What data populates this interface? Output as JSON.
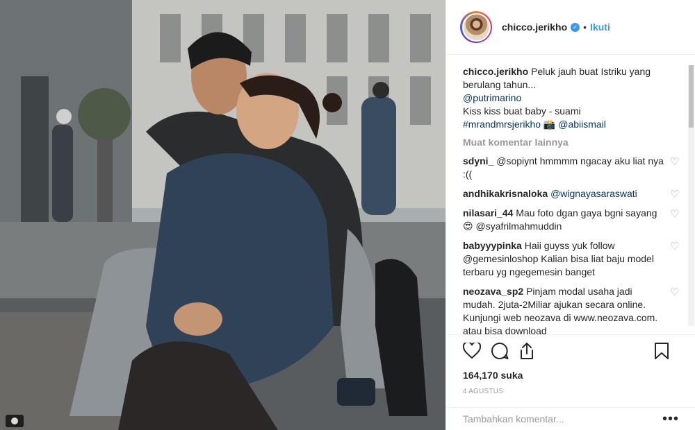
{
  "post": {
    "username": "chicco.jerikho",
    "follow_label": "Ikuti",
    "separator": "•",
    "caption_lines": [
      "Peluk jauh buat Istriku yang berulang tahun...",
      "@putrimarino",
      "Kiss kiss buat baby - suami",
      "#mrandmrsjerikho 📸 @abiismail"
    ],
    "load_more_label": "Muat komentar lainnya",
    "likes": "164,170 suka",
    "date": "4 AGUSTUS",
    "add_comment_placeholder": "Tambahkan komentar...",
    "more_options": "•••"
  },
  "comments": [
    {
      "user": "sdyni_",
      "text": "@sopiynt hmmmm ngacay aku liat nya :(("
    },
    {
      "user": "andhikakrisnaloka",
      "text": "@wignayasaraswati"
    },
    {
      "user": "nilasari_44",
      "text": "Mau foto dgan gaya bgni sayang 😍 @syafrilmahmuddin"
    },
    {
      "user": "babyyypinka",
      "text": "Haii guyss yuk follow @gemesinloshop Kalian bisa liat baju model terbaru yg ngegemesin banget"
    },
    {
      "user": "neozava_sp2",
      "text": "Pinjam modal usaha jadi mudah. 2juta-2Miliar ajukan secara online. Kunjungi web neozava di www.neozava.com. atau bisa download"
    }
  ],
  "icons": {
    "heart": "heart-icon",
    "comment": "comment-icon",
    "share": "share-icon",
    "bookmark": "bookmark-icon",
    "verified": "verified-badge-icon"
  },
  "colors": {
    "link": "#3897f0",
    "tag": "#003569",
    "muted": "#999999",
    "text": "#262626"
  }
}
